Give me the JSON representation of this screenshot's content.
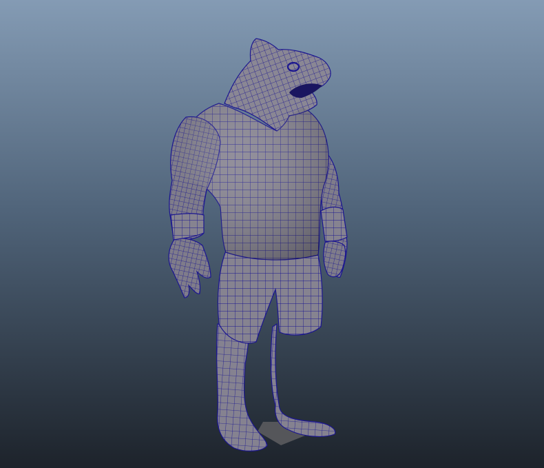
{
  "viewport": {
    "background_top": "#849bb4",
    "background_mid": "#50647a",
    "background_bottom": "#1d232b"
  },
  "model": {
    "name": "shark-man-character",
    "shading_mode": "wireframe-on-shaded",
    "surface_color": "#868390",
    "wire_color": "#1b1690",
    "ground_plane_color": "#55565a"
  }
}
